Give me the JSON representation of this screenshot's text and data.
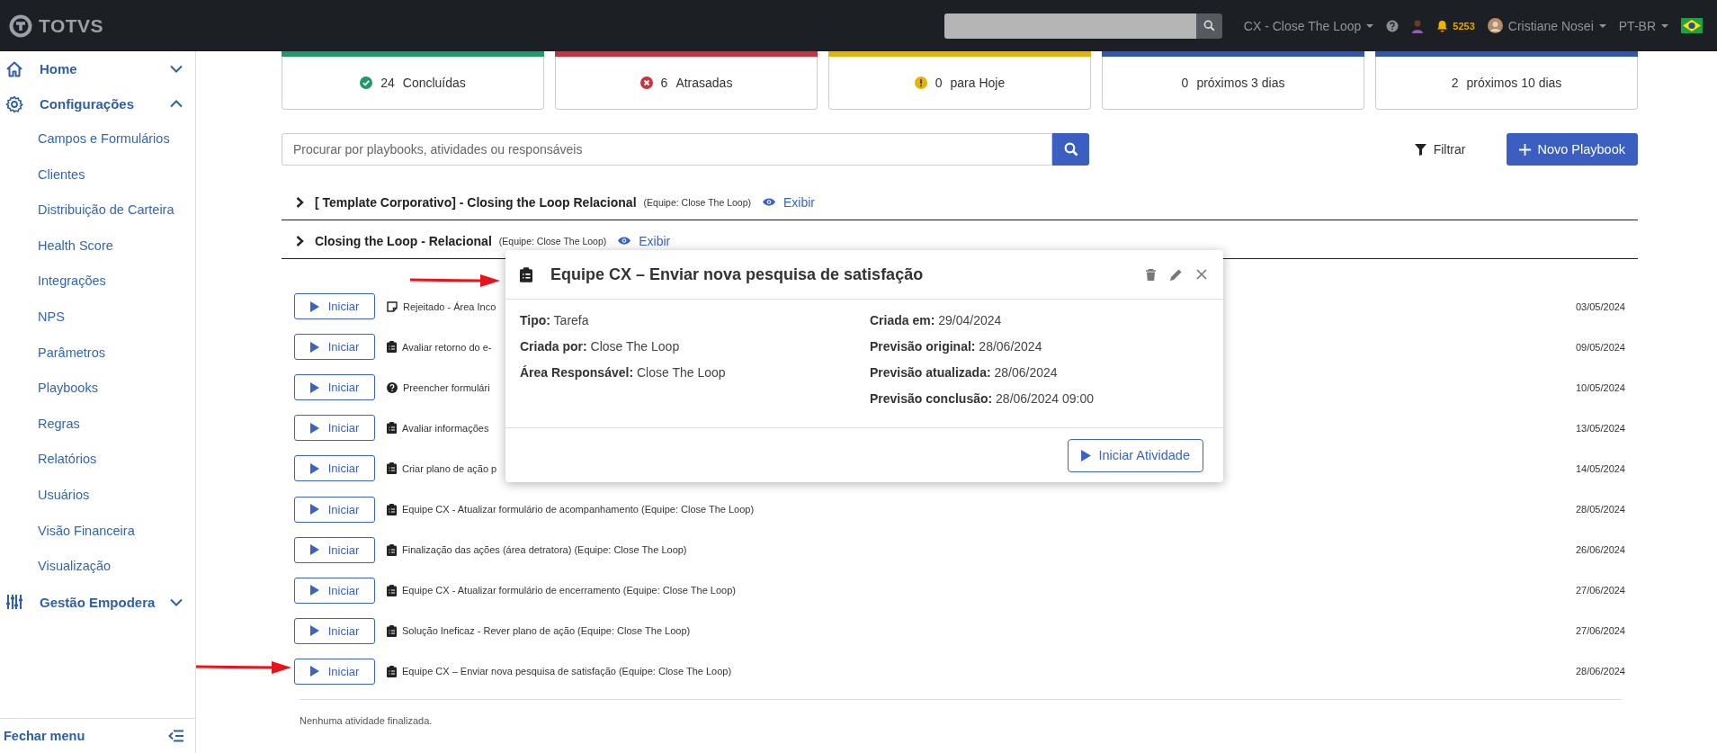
{
  "topbar": {
    "logo": "TOTVS",
    "workspace": "CX - Close The Loop",
    "notifications": "5253",
    "user": "Cristiane Nosei",
    "language": "PT-BR"
  },
  "sidebar": {
    "items": [
      {
        "label": "Home",
        "kind": "home",
        "expanded": false
      },
      {
        "label": "Configurações",
        "kind": "gear",
        "expanded": true,
        "children": [
          {
            "label": "Campos e Formulários"
          },
          {
            "label": "Clientes"
          },
          {
            "label": "Distribuição de Carteira"
          },
          {
            "label": "Health Score"
          },
          {
            "label": "Integrações"
          },
          {
            "label": "NPS"
          },
          {
            "label": "Parâmetros"
          },
          {
            "label": "Playbooks"
          },
          {
            "label": "Regras"
          },
          {
            "label": "Relatórios"
          },
          {
            "label": "Usuários"
          },
          {
            "label": "Visão Financeira"
          },
          {
            "label": "Visualização"
          }
        ]
      },
      {
        "label": "Gestão Empodera",
        "kind": "sliders",
        "expanded": false
      }
    ],
    "footer": "Fechar menu"
  },
  "summary_cards": [
    {
      "count": "24",
      "label": "Concluídas",
      "color": "#1f9a68",
      "kind": "check"
    },
    {
      "count": "6",
      "label": "Atrasadas",
      "color": "#c8343e",
      "kind": "cross"
    },
    {
      "count": "0",
      "label": "para Hoje",
      "color": "#e5b20a",
      "kind": "alert"
    },
    {
      "count": "0",
      "label": "próximos 3 dias",
      "color": "#2f55b5",
      "kind": "plain"
    },
    {
      "count": "2",
      "label": "próximos 10 dias",
      "color": "#2f55b5",
      "kind": "plain"
    }
  ],
  "search": {
    "placeholder": "Procurar por playbooks, atividades ou responsáveis"
  },
  "filter_button": "Filtrar",
  "new_button": "Novo Playbook",
  "playbooks": [
    {
      "title": "[ Template Corporativo] - Closing the Loop Relacional",
      "team": "(Equipe: Close The Loop)",
      "action": "Exibir",
      "expanded": false
    },
    {
      "title": "Closing the Loop - Relacional",
      "team": "(Equipe: Close The Loop)",
      "action": "Exibir",
      "expanded": false
    }
  ],
  "activities": [
    {
      "button": "Iniciar",
      "kind": "note",
      "title": "Rejeitado - Área Inco",
      "date": "03/05/2024"
    },
    {
      "button": "Iniciar",
      "kind": "clipboard",
      "title": "Avaliar retorno do e-",
      "date": "09/05/2024"
    },
    {
      "button": "Iniciar",
      "kind": "question",
      "title": "Preencher formulári",
      "date": "10/05/2024"
    },
    {
      "button": "Iniciar",
      "kind": "clipboard",
      "title": "Avaliar informações",
      "date": "13/05/2024"
    },
    {
      "button": "Iniciar",
      "kind": "clipboard",
      "title": "Criar plano de ação p",
      "date": "14/05/2024"
    },
    {
      "button": "Iniciar",
      "kind": "clipboard",
      "title": "Equipe CX - Atualizar formulário de acompanhamento (Equipe: Close The Loop)",
      "date": "28/05/2024"
    },
    {
      "button": "Iniciar",
      "kind": "clipboard",
      "title": "Finalização das ações (área detratora) (Equipe: Close The Loop)",
      "date": "26/06/2024"
    },
    {
      "button": "Iniciar",
      "kind": "clipboard",
      "title": "Equipe CX - Atualizar formulário de encerramento (Equipe: Close The Loop)",
      "date": "27/06/2024"
    },
    {
      "button": "Iniciar",
      "kind": "clipboard",
      "title": "Solução Ineficaz - Rever plano de ação (Equipe: Close The Loop)",
      "date": "27/06/2024"
    },
    {
      "button": "Iniciar",
      "kind": "clipboard",
      "title": "Equipe CX – Enviar nova pesquisa de satisfação (Equipe: Close The Loop)",
      "date": "28/06/2024"
    }
  ],
  "empty_message": "Nenhuma atividade finalizada.",
  "modal": {
    "title": "Equipe CX – Enviar nova pesquisa de satisfação",
    "left": [
      {
        "label": "Tipo:",
        "value": "Tarefa"
      },
      {
        "label": "Criada por:",
        "value": "Close The Loop"
      },
      {
        "label": "Área Responsável:",
        "value": "Close The Loop"
      }
    ],
    "right": [
      {
        "label": "Criada em:",
        "value": "29/04/2024"
      },
      {
        "label": "Previsão original:",
        "value": "28/06/2024"
      },
      {
        "label": "Previsão atualizada:",
        "value": "28/06/2024"
      },
      {
        "label": "Previsão conclusão:",
        "value": "28/06/2024 09:00"
      }
    ],
    "button": "Iniciar Atividade"
  }
}
